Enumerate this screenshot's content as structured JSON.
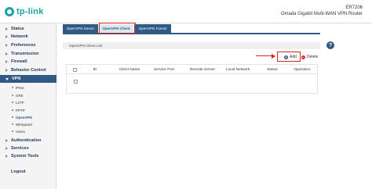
{
  "header": {
    "brand": "tp-link",
    "model": "ER7206",
    "subtitle": "Omada Gigabit Multi-WAN VPN Router",
    "brand_color": "#1aa3a3"
  },
  "sidebar": {
    "items": [
      {
        "label": "Status",
        "expanded": false
      },
      {
        "label": "Network",
        "expanded": false
      },
      {
        "label": "Preferences",
        "expanded": false
      },
      {
        "label": "Transmission",
        "expanded": false
      },
      {
        "label": "Firewall",
        "expanded": false
      },
      {
        "label": "Behavior Control",
        "expanded": false
      },
      {
        "label": "VPN",
        "expanded": true
      },
      {
        "label": "Authentication",
        "expanded": false
      },
      {
        "label": "Services",
        "expanded": false
      },
      {
        "label": "System Tools",
        "expanded": false
      },
      {
        "label": "Logout",
        "expanded": false
      }
    ],
    "vpn_sub_items": [
      {
        "label": "IPsec",
        "current": false
      },
      {
        "label": "GRE",
        "current": false
      },
      {
        "label": "L2TP",
        "current": false
      },
      {
        "label": "PPTP",
        "current": false
      },
      {
        "label": "OpenVPN",
        "current": true
      },
      {
        "label": "Wireguard",
        "current": false
      },
      {
        "label": "Users",
        "current": false
      }
    ],
    "active_color": "#2f5a85"
  },
  "tabs": [
    {
      "label": "OpenVPN Server",
      "active": false
    },
    {
      "label": "OpenVPN Client",
      "active": true
    },
    {
      "label": "OpenVPN Tunnel",
      "active": false
    }
  ],
  "panel": {
    "title": "OpenVPN Client List",
    "help_icon": "question-circle-icon"
  },
  "toolbar": {
    "add_label": "Add",
    "add_icon": "plus-circle-icon",
    "delete_label": "Delete",
    "delete_icon": "minus-circle-icon",
    "highlight_color": "#d6261f"
  },
  "table": {
    "columns": [
      "",
      "ID",
      "Client Name",
      "Service Port",
      "Remote Server",
      "Local Network",
      "Status",
      "Operation"
    ],
    "rows": []
  }
}
